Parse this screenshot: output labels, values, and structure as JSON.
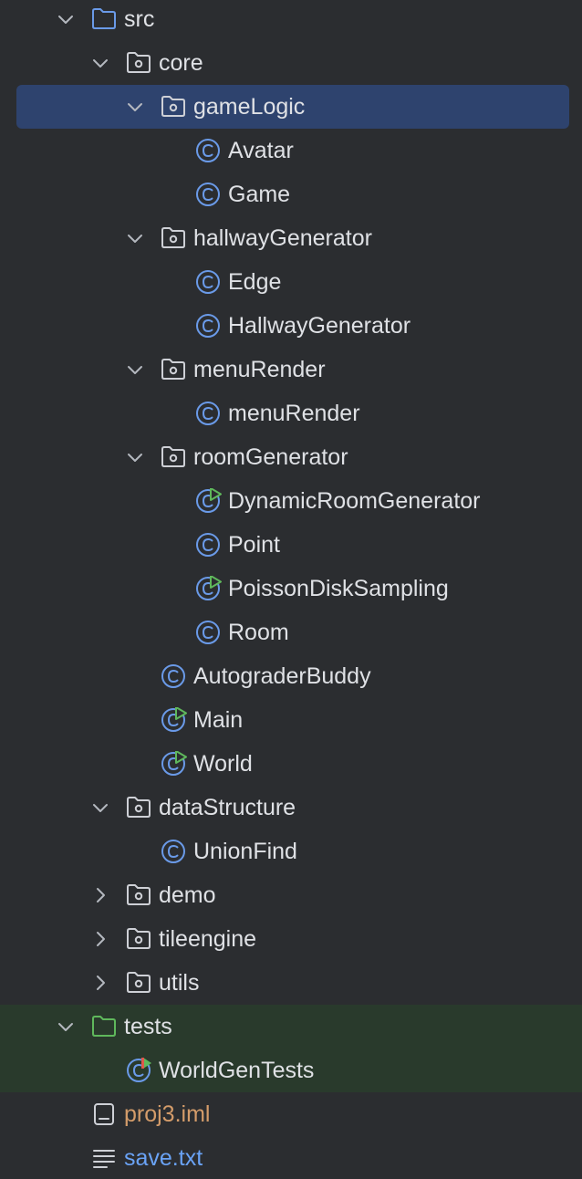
{
  "colors": {
    "background": "#2b2d30",
    "selection": "#2e436e",
    "tests_background": "#293a2c",
    "text": "#dfe1e5",
    "class_icon": "#6a9ae8",
    "run_badge": "#5fb85c",
    "iml_text": "#d49c6a",
    "txt_text": "#6aa3f6"
  },
  "tree": {
    "src": {
      "label": "src",
      "icon": "folder-icon",
      "expanded": true
    },
    "core": {
      "label": "core",
      "icon": "package-folder-icon",
      "expanded": true
    },
    "gameLogic": {
      "label": "gameLogic",
      "icon": "package-folder-icon",
      "expanded": true,
      "selected": true
    },
    "avatar": {
      "label": "Avatar",
      "icon": "class-icon"
    },
    "game": {
      "label": "Game",
      "icon": "class-icon"
    },
    "hallwayGenerator": {
      "label": "hallwayGenerator",
      "icon": "package-folder-icon",
      "expanded": true
    },
    "edge": {
      "label": "Edge",
      "icon": "class-icon"
    },
    "hallwayGeneratorClass": {
      "label": "HallwayGenerator",
      "icon": "class-icon"
    },
    "menuRenderPkg": {
      "label": "menuRender",
      "icon": "package-folder-icon",
      "expanded": true
    },
    "menuRenderClass": {
      "label": "menuRender",
      "icon": "class-icon"
    },
    "roomGenerator": {
      "label": "roomGenerator",
      "icon": "package-folder-icon",
      "expanded": true
    },
    "dynamicRoomGenerator": {
      "label": "DynamicRoomGenerator",
      "icon": "runnable-class-icon"
    },
    "point": {
      "label": "Point",
      "icon": "class-icon"
    },
    "poissonDiskSampling": {
      "label": "PoissonDiskSampling",
      "icon": "runnable-class-icon"
    },
    "room": {
      "label": "Room",
      "icon": "class-icon"
    },
    "autograderBuddy": {
      "label": "AutograderBuddy",
      "icon": "class-icon"
    },
    "main": {
      "label": "Main",
      "icon": "runnable-class-icon"
    },
    "world": {
      "label": "World",
      "icon": "runnable-class-icon"
    },
    "dataStructure": {
      "label": "dataStructure",
      "icon": "package-folder-icon",
      "expanded": true
    },
    "unionFind": {
      "label": "UnionFind",
      "icon": "class-icon"
    },
    "demo": {
      "label": "demo",
      "icon": "package-folder-icon",
      "expanded": false
    },
    "tileengine": {
      "label": "tileengine",
      "icon": "package-folder-icon",
      "expanded": false
    },
    "utils": {
      "label": "utils",
      "icon": "package-folder-icon",
      "expanded": false
    },
    "tests": {
      "label": "tests",
      "icon": "test-folder-icon",
      "expanded": true
    },
    "worldGenTests": {
      "label": "WorldGenTests",
      "icon": "test-class-icon"
    },
    "proj3iml": {
      "label": "proj3.iml",
      "icon": "iml-file-icon"
    },
    "saveTxt": {
      "label": "save.txt",
      "icon": "text-file-icon"
    }
  }
}
